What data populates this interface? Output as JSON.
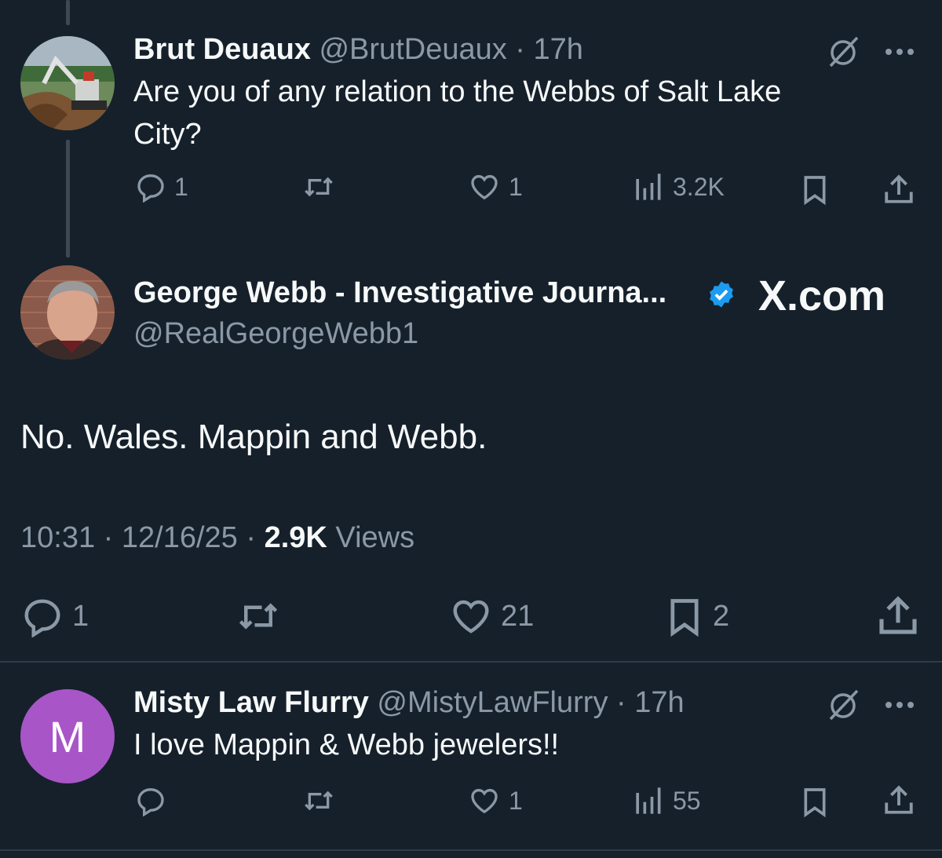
{
  "reply1": {
    "name": "Brut Deuaux",
    "handle": "@BrutDeuaux",
    "time": "17h",
    "text_line1": "Are you of any relation to the Webbs of Salt Lake",
    "text_line2": "City?",
    "replies": "1",
    "likes": "1",
    "views": "3.2K"
  },
  "main": {
    "name": "George Webb - Investigative Journa...",
    "handle": "@RealGeorgeWebb1",
    "watermark": "X.com",
    "text": "No. Wales. Mappin and Webb.",
    "time": "10:31",
    "date": "12/16/25",
    "views_count": "2.9K",
    "views_label": "Views",
    "replies": "1",
    "likes": "21",
    "bookmarks": "2"
  },
  "reply2": {
    "name": "Misty Law Flurry",
    "handle": "@MistyLawFlurry",
    "time": "17h",
    "avatar_letter": "M",
    "text": "I love Mappin & Webb jewelers!!",
    "likes": "1",
    "views": "55"
  },
  "colors": {
    "background": "#15202b",
    "text": "#f7f9f9",
    "muted": "#8b98a5",
    "verified": "#1d9bf0",
    "avatar_purple": "#a855c7"
  }
}
